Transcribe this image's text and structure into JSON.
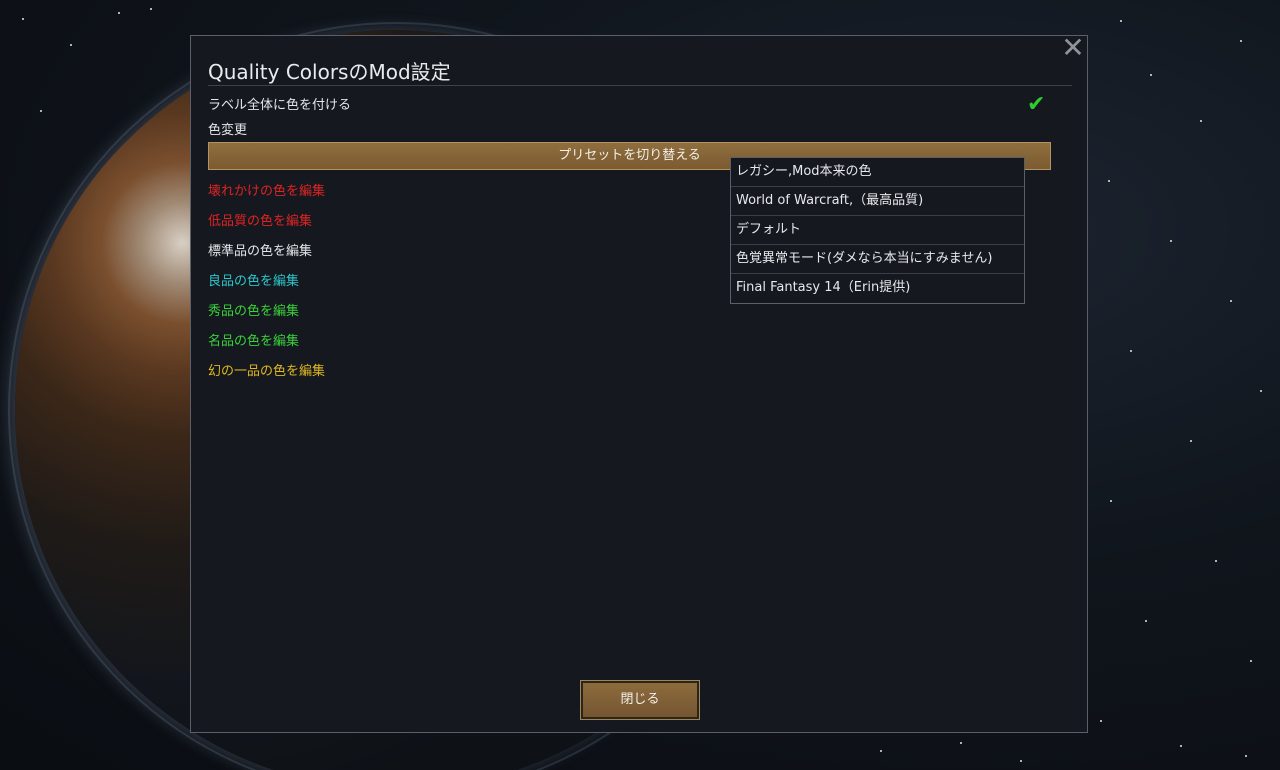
{
  "dialog": {
    "title": "Quality ColorsのMod設定",
    "close_icon": "close-icon",
    "label_colorize": "ラベル全体に色を付ける",
    "label_colorize_checked": true,
    "color_change_label": "色変更",
    "preset_button_label": "プリセットを切り替える",
    "edit_links": [
      {
        "label": "壊れかけの色を編集",
        "color": "#e02323"
      },
      {
        "label": "低品質の色を編集",
        "color": "#e02323"
      },
      {
        "label": "標準品の色を編集",
        "color": "#e3e6e9"
      },
      {
        "label": "良品の色を編集",
        "color": "#2bc6cc"
      },
      {
        "label": "秀品の色を編集",
        "color": "#3ad13a"
      },
      {
        "label": "名品の色を編集",
        "color": "#3ad13a"
      },
      {
        "label": "幻の一品の色を編集",
        "color": "#e0b81f"
      }
    ],
    "preset_options": [
      "レガシー,Mod本来の色",
      "World of Warcraft,（最高品質)",
      "デフォルト",
      "色覚異常モード(ダメなら本当にすみません)",
      "Final Fantasy 14（Erin提供)"
    ],
    "close_button_label": "閉じる"
  },
  "colors": {
    "checkmark": "#2ecc2e",
    "button_brown": "#8c6b3c",
    "dialog_bg": "#15191f"
  }
}
